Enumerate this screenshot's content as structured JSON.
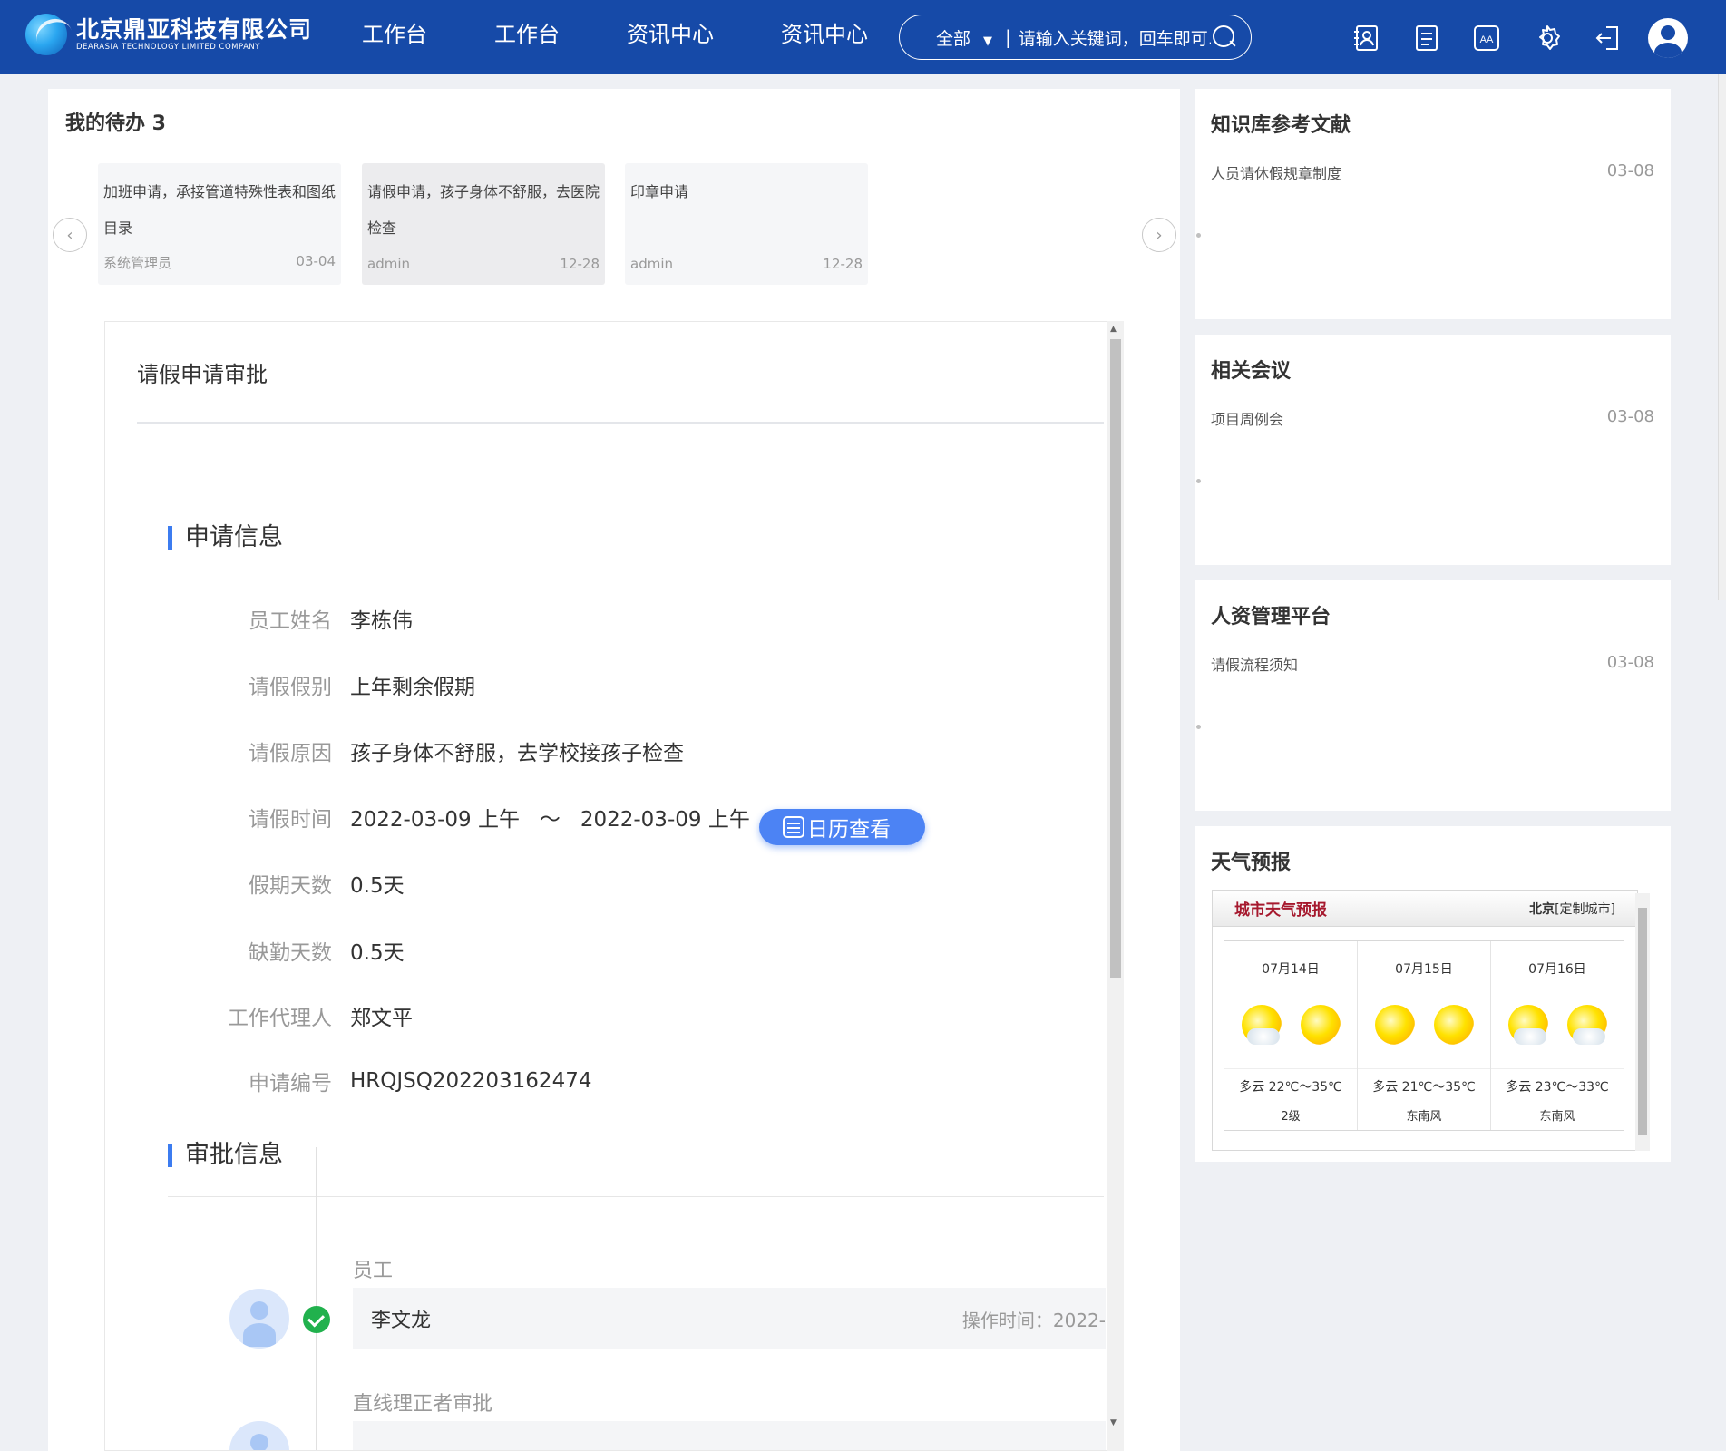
{
  "header": {
    "logo": {
      "cn": "北京鼎亚科技有限公司",
      "en": "DEARASIA TECHNOLOGY LIMITED COMPANY"
    },
    "nav": [
      "工作台",
      "工作台",
      "资讯中心",
      "资讯中心"
    ],
    "search": {
      "scope": "全部",
      "placeholder": "请输入关键词，回车即可..."
    },
    "icons": [
      "contacts-icon",
      "notes-icon",
      "font-size-icon",
      "gear-icon",
      "logout-icon",
      "user-avatar-icon"
    ],
    "brand_color": "#164aa8"
  },
  "todo": {
    "title": "我的待办 3",
    "items": [
      {
        "text": "加班申请，承接管道特殊性表和图纸目录",
        "author": "系统管理员",
        "date": "03-04"
      },
      {
        "text": "请假申请，孩子身体不舒服，去医院检查",
        "author": "admin",
        "date": "12-28"
      },
      {
        "text": "印章申请",
        "author": "admin",
        "date": "12-28"
      }
    ]
  },
  "form": {
    "title": "请假申请审批",
    "section_apply": "申请信息",
    "fields": [
      {
        "label": "员工姓名",
        "value": "李栋伟"
      },
      {
        "label": "请假假别",
        "value": "上年剩余假期"
      },
      {
        "label": "请假原因",
        "value": "孩子身体不舒服，去学校接孩子检查"
      },
      {
        "label": "请假时间",
        "value": "2022-03-09 上午   ～   2022-03-09 上午"
      },
      {
        "label": "假期天数",
        "value": "0.5天"
      },
      {
        "label": "缺勤天数",
        "value": "0.5天"
      },
      {
        "label": "工作代理人",
        "value": "郑文平"
      },
      {
        "label": "申请编号",
        "value": "HRQJSQ202203162474"
      }
    ],
    "calendar_button": "日历查看",
    "section_approve": "审批信息",
    "steps": [
      {
        "title": "员工",
        "name": "李文龙",
        "time": "操作时间：2022-"
      },
      {
        "title": "直线理正者审批",
        "name": "",
        "time": ""
      }
    ],
    "accent_color": "#3c7cf0"
  },
  "cards": [
    {
      "title": "知识库参考文献",
      "item": "人员请休假规章制度",
      "date": "03-08"
    },
    {
      "title": "相关会议",
      "item": "项目周例会",
      "date": "03-08"
    },
    {
      "title": "人资管理平台",
      "item": "请假流程须知",
      "date": "03-08"
    }
  ],
  "weather": {
    "title": "天气预报",
    "widget_title": "城市天气预报",
    "city": "北京",
    "custom": "[定制城市]",
    "days": [
      {
        "date": "07月14日",
        "icons": [
          "partly-cloudy-icon",
          "sunny-icon"
        ],
        "temp": "多云 22℃～35℃",
        "wind": "2级"
      },
      {
        "date": "07月15日",
        "icons": [
          "sunny-icon",
          "sunny-icon"
        ],
        "temp": "多云 21℃～35℃",
        "wind": "东南风"
      },
      {
        "date": "07月16日",
        "icons": [
          "partly-cloudy-icon",
          "partly-cloudy-icon"
        ],
        "temp": "多云 23℃～33℃",
        "wind": "东南风"
      }
    ]
  }
}
